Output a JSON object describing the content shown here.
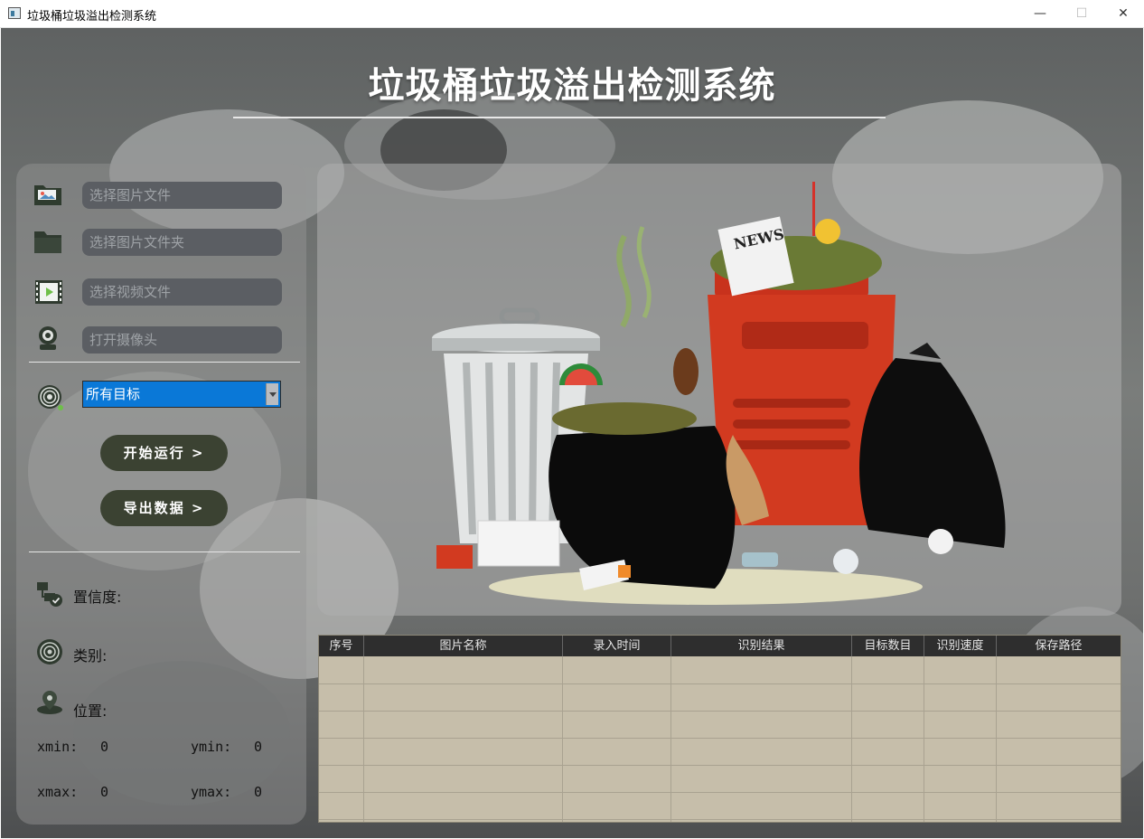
{
  "window": {
    "title": "垃圾桶垃圾溢出检测系统",
    "min_glyph": "—",
    "max_glyph": "☐",
    "close_glyph": "✕"
  },
  "header": {
    "title": "垃圾桶垃圾溢出检测系统"
  },
  "sidebar": {
    "file_inputs": [
      {
        "placeholder": "选择图片文件",
        "icon": "image-file-icon"
      },
      {
        "placeholder": "选择图片文件夹",
        "icon": "folder-icon"
      },
      {
        "placeholder": "选择视频文件",
        "icon": "video-file-icon"
      },
      {
        "placeholder": "打开摄像头",
        "icon": "camera-icon"
      }
    ],
    "target_select": {
      "selected": "所有目标",
      "icon": "target-icon"
    },
    "start_button": "开始运行 >",
    "export_button": "导出数据 >",
    "info": {
      "confidence_label": "置信度:",
      "class_label": "类别:",
      "position_label": "位置:"
    },
    "coords": {
      "xmin_label": "xmin:",
      "xmin_value": "0",
      "ymin_label": "ymin:",
      "ymin_value": "0",
      "xmax_label": "xmax:",
      "xmax_value": "0",
      "ymax_label": "ymax:",
      "ymax_value": "0"
    }
  },
  "preview": {
    "newspaper_text": "NEWS"
  },
  "table": {
    "columns": [
      "序号",
      "图片名称",
      "录入时间",
      "识别结果",
      "目标数目",
      "识别速度",
      "保存路径"
    ],
    "rows": [
      [
        "",
        "",
        "",
        "",
        "",
        "",
        ""
      ],
      [
        "",
        "",
        "",
        "",
        "",
        "",
        ""
      ],
      [
        "",
        "",
        "",
        "",
        "",
        "",
        ""
      ],
      [
        "",
        "",
        "",
        "",
        "",
        "",
        ""
      ],
      [
        "",
        "",
        "",
        "",
        "",
        "",
        ""
      ],
      [
        "",
        "",
        "",
        "",
        "",
        "",
        ""
      ]
    ]
  },
  "colors": {
    "accent_select": "#0a78d7",
    "button_bg": "#3b4232",
    "table_bg": "#c6beaa",
    "table_header": "#2e2e2e",
    "red_bin": "#c8321c"
  }
}
